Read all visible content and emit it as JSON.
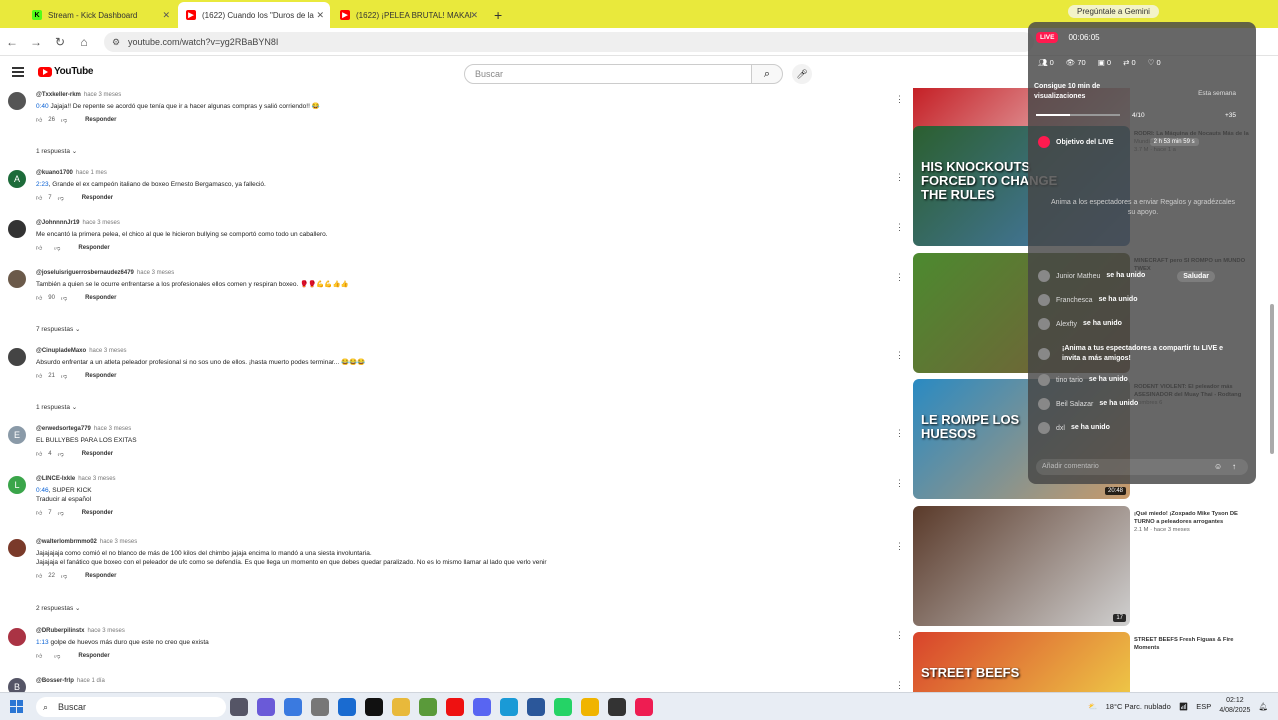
{
  "browser": {
    "tabs": [
      {
        "title": "Stream - Kick Dashboard",
        "color": "#53fc18",
        "fav_letter": "K",
        "active": false
      },
      {
        "title": "(1622) Cuando los \"Duros de la",
        "color": "#ff0000",
        "fav_letter": "▶",
        "active": true
      },
      {
        "title": "(1622) ¡PELEA BRUTAL! MAKAI",
        "color": "#ff0000",
        "fav_letter": "▶",
        "active": false
      }
    ],
    "new_tab": "+",
    "gemini_label": "Pregúntale a Gemini",
    "url": "youtube.com/watch?v=yg2RBaBYN8I"
  },
  "youtube": {
    "logo_text": "YouTube",
    "search_placeholder": "Buscar"
  },
  "comments": [
    {
      "handle": "@Txxkeller-rkm",
      "ago": "hace 3 meses",
      "ts": "0:40",
      "text": " Jajaja!! De repente se acordó que tenía que ir a hacer algunas compras y salió corriendo!! 😂",
      "likes": "26",
      "avatar_color": "#555",
      "avatar_letter": "",
      "replies": "1 respuesta"
    },
    {
      "handle": "@kuano1700",
      "ago": "hace 1 mes",
      "ts": "2:23",
      "text": ", Grande el ex campeón italiano de boxeo Ernesto Bergamasco, ya falleció.",
      "likes": "7",
      "avatar_color": "#1d6b3a",
      "avatar_letter": "A",
      "replies": ""
    },
    {
      "handle": "@JohnnnnJr19",
      "ago": "hace 3 meses",
      "ts": "",
      "text": "Me encantó la primera pelea, el chico al que le hicieron bullying se comportó como todo un caballero.",
      "likes": "",
      "avatar_color": "#333",
      "avatar_letter": "",
      "replies": ""
    },
    {
      "handle": "@joseluisriguerrosbernaudez6479",
      "ago": "hace 3 meses",
      "ts": "",
      "text": "También a quien se le ocurre enfrentarse a los profesionales ellos comen y respiran boxeo. 🥊🥊💪💪👍👍",
      "likes": "90",
      "avatar_color": "#6b5a4a",
      "avatar_letter": "",
      "replies": "7 respuestas"
    },
    {
      "handle": "@CinupladeMaxo",
      "ago": "hace 3 meses",
      "ts": "",
      "text": "Absurdo enfrentar a un atleta peleador profesional si no sos uno de ellos. ¡hasta muerto podes terminar... 😂😂😂",
      "likes": "21",
      "avatar_color": "#444",
      "avatar_letter": "",
      "replies": "1 respuesta"
    },
    {
      "handle": "@erwedsortega779",
      "ago": "hace 3 meses",
      "ts": "",
      "text": "EL BULLYBES PARA LOS EXITAS",
      "likes": "4",
      "avatar_color": "#8a9aa8",
      "avatar_letter": "E",
      "replies": ""
    },
    {
      "handle": "@LINCE-lxkle",
      "ago": "hace 3 meses",
      "ts": "0:46",
      "text": ", SUPER KICK\nTraducir al español",
      "likes": "7",
      "avatar_color": "#3aa54a",
      "avatar_letter": "L",
      "replies": ""
    },
    {
      "handle": "@walterlombrmmo02",
      "ago": "hace 3 meses",
      "ts": "",
      "text": "Jajajajaja como comió el no blanco de más de 100 kilos del chimbo jajaja encima lo mandó a una siesta involuntaria.\nJajajaja el fanático que boxeo con el peleador de ufc como se defendía. Es que llega un momento en que debes quedar paralizado. No es lo mismo llamar al lado que verlo venir",
      "likes": "22",
      "avatar_color": "#7a3a2a",
      "avatar_letter": "",
      "replies": "2 respuestas"
    },
    {
      "handle": "@DRuberpilinstx",
      "ago": "hace 3 meses",
      "ts": "1:13",
      "text": " golpe de huevos más duro que este no creo que exista",
      "likes": "",
      "avatar_color": "#a34",
      "avatar_letter": "",
      "replies": ""
    },
    {
      "handle": "@Bosser-frlp",
      "ago": "hace 1 día",
      "ts": "",
      "text": "",
      "likes": "",
      "avatar_color": "#556",
      "avatar_letter": "B",
      "replies": ""
    }
  ],
  "reply_label": "Responder",
  "videos": [
    {
      "title": "",
      "channel": "",
      "color1": "#c41c22",
      "color2": "#f5f5f5",
      "overlay": ""
    },
    {
      "title": "RODRI: La Máquina de Nocauts Más de la",
      "channel": "Mundial",
      "meta": "3.7 M · hace 1 a",
      "color1": "#2b5f2f",
      "color2": "#4a7bb8",
      "overlay": "HIS KNOCKOUTS FORCED TO CHANGE THE RULES"
    },
    {
      "title": "MINECRAFT pero SI ROMPO un MUNDO TWEX",
      "channel": "",
      "meta": "",
      "color1": "#4c8a2f",
      "color2": "#7a5a3a",
      "overlay": ""
    },
    {
      "title": "RODENT VIOLENT: El peleador más ASESINADOR del Muay Thai - Rodtang",
      "channel": "Hombres 6",
      "meta": "",
      "color1": "#2a8ac2",
      "color2": "#c99a6a",
      "overlay": "LE ROMPE LOS HUESOS",
      "duration": "20:48"
    },
    {
      "title": "¡Qué miedo! ¡Zoxpado Mike Tyson DE TURNO a peleadores arrogantes",
      "channel": "",
      "meta": "2.1 M · hace 3 meses",
      "color1": "#5a3a2a",
      "color2": "#d0d0d0",
      "overlay": "",
      "duration": "17"
    },
    {
      "title": "STREET BEEFS Fresh Figuas & Fire Moments",
      "channel": "",
      "meta": "",
      "color1": "#d8432b",
      "color2": "#f2e14c",
      "overlay": "STREET BEEFS"
    }
  ],
  "live_panel": {
    "badge": "LIVE",
    "timer": "00:06:05",
    "stats": [
      "0",
      "70",
      "0",
      "0",
      "0"
    ],
    "goal_title": "Consigue 10 min de visualizaciones",
    "goal_progress_text": "4/10",
    "goal_progress": 0.4,
    "goal_extra": "+35",
    "goal_week": "Esta semana",
    "objective_label": "Objetivo del LIVE",
    "objective_meta": "2 h 53 min 59 s",
    "encourage": "Anima a los espectadores a enviar Regalos y agradézcales su apoyo.",
    "events": [
      {
        "name": "Junior Matheu",
        "action": "se ha unido",
        "extra": "Saludar"
      },
      {
        "name": "Franchesca",
        "action": "se ha unido"
      },
      {
        "name": "Alexfty",
        "action": "se ha unido"
      },
      {
        "name": "",
        "action": "¡Anima a tus espectadores a compartir tu LIVE e invita a más amigos!"
      },
      {
        "name": "tino tario",
        "action": "se ha unido"
      },
      {
        "name": "Beil Salazar",
        "action": "se ha unido"
      },
      {
        "name": "dxl",
        "action": "se ha unido"
      }
    ],
    "input_placeholder": "Añadir comentario"
  },
  "taskbar": {
    "search": "Buscar",
    "weather": "18°C  Parc. nublado",
    "lang": "ESP",
    "time": "02:12",
    "date": "4/08/2025"
  }
}
